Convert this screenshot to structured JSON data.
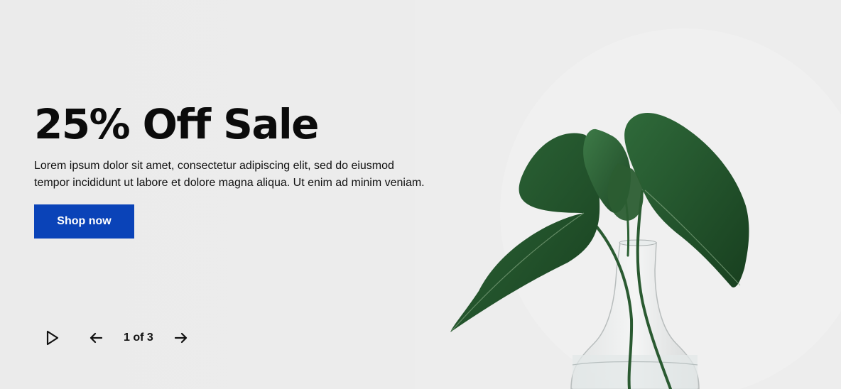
{
  "hero": {
    "headline": "25% Off Sale",
    "body": "Lorem ipsum dolor sit amet, consectetur adipiscing elit, sed do eiusmod tempor incididunt ut labore et dolore magna aliqua. Ut enim ad minim veniam.",
    "cta_label": "Shop now"
  },
  "slider": {
    "counter_text": "1 of 3",
    "current_slide": 1,
    "total_slides": 3,
    "controls": {
      "play_icon": "play-icon",
      "prev_icon": "arrow-left-icon",
      "next_icon": "arrow-right-icon"
    }
  },
  "image": {
    "subject": "leafy plant in glass vase"
  },
  "colors": {
    "background": "#ececec",
    "button_bg": "#0a43b8",
    "button_text": "#ffffff",
    "text": "#111111"
  }
}
